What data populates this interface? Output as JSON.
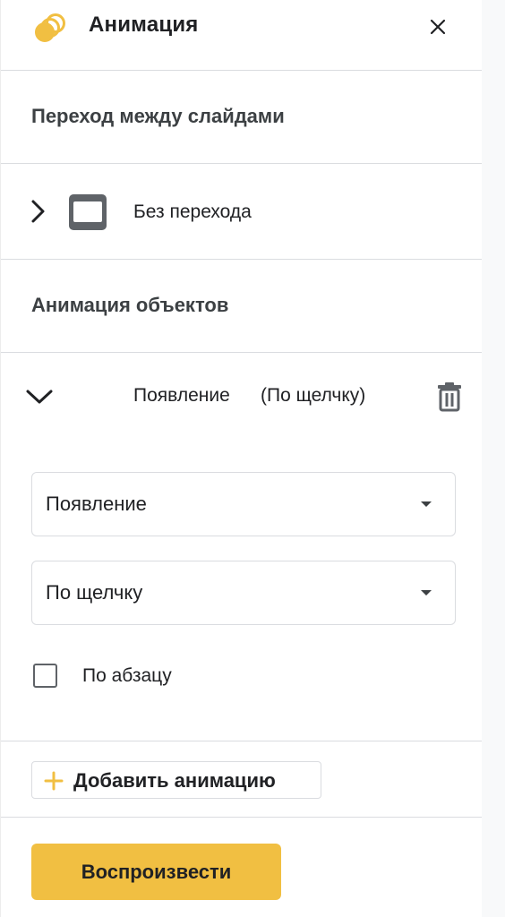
{
  "panel": {
    "title": "Анимация",
    "accent_color": "#f1bf42",
    "logo_icon": "animation-rings-icon",
    "close_icon": "close-icon"
  },
  "slide_transition": {
    "heading": "Переход между слайдами",
    "expand_icon": "chevron-right-icon",
    "thumbnail_icon": "slide-icon",
    "value": "Без перехода"
  },
  "object_animation": {
    "heading": "Анимация объектов",
    "item": {
      "collapse_icon": "chevron-down-icon",
      "name": "Появление",
      "trigger": "(По щелчку)",
      "delete_icon": "trash-icon"
    },
    "effect_select": {
      "value": "Появление"
    },
    "trigger_select": {
      "value": "По щелчку"
    },
    "by_paragraph": {
      "label": "По абзацу",
      "checked": false
    }
  },
  "add_animation": {
    "label": "Добавить анимацию",
    "icon": "plus-icon"
  },
  "play_button": {
    "label": "Воспроизвести"
  }
}
